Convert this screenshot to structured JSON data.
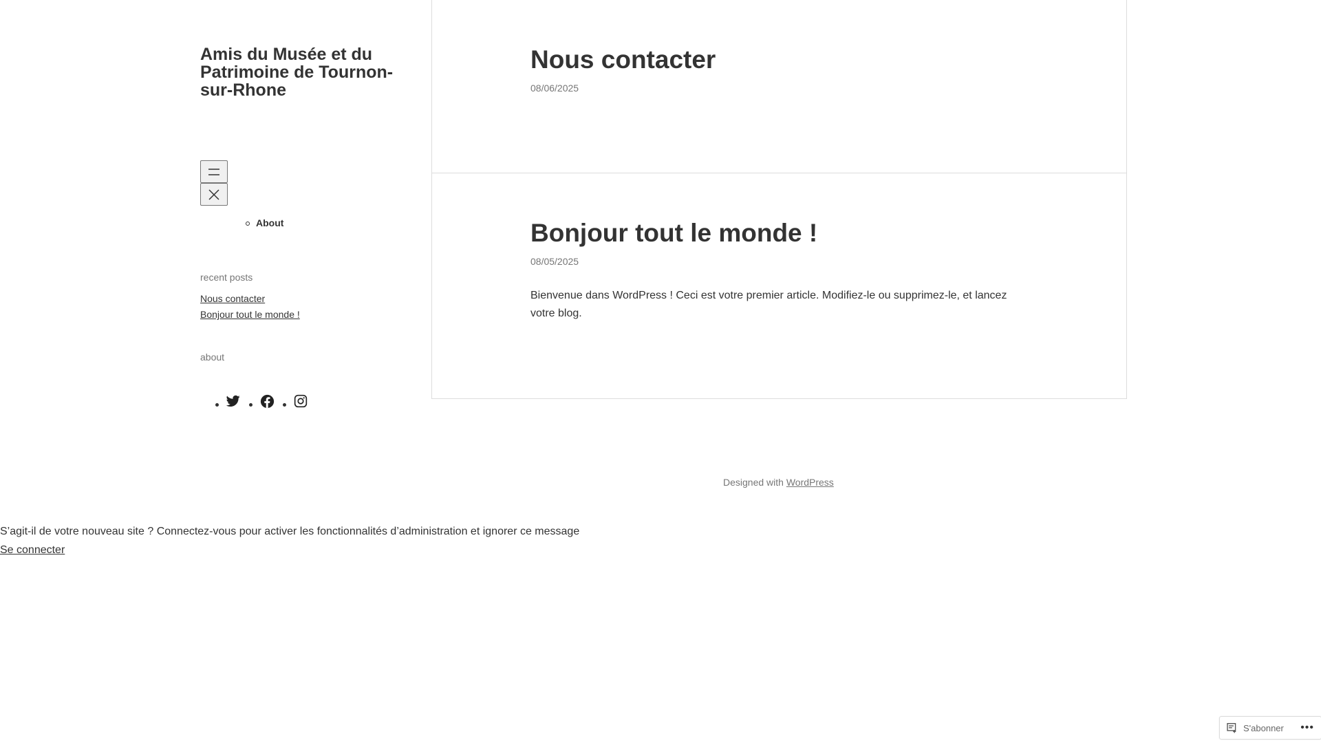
{
  "site": {
    "title": "Amis du Musée et du Patrimoine de Tournon-sur-Rhone"
  },
  "navigation": {
    "items": [
      {
        "label": "About"
      }
    ]
  },
  "sidebar": {
    "recent_posts_title": "recent posts",
    "recent_posts": [
      {
        "label": "Nous contacter"
      },
      {
        "label": "Bonjour tout le monde !"
      }
    ],
    "about_title": "about",
    "social_icons": [
      "twitter-icon",
      "facebook-icon",
      "instagram-icon"
    ]
  },
  "posts": [
    {
      "title": "Nous contacter",
      "date": "08/06/2025"
    },
    {
      "title": "Bonjour tout le monde !",
      "date": "08/05/2025",
      "body": "Bienvenue dans WordPress ! Ceci est votre premier article. Modifiez-le ou supprimez-le, et lancez votre blog."
    }
  ],
  "footer": {
    "prefix": "Designed with",
    "link_label": "WordPress"
  },
  "notice": {
    "message": "S’agit-il de votre nouveau site ? Connectez-vous pour activer les fonctionnalités d’administration et ignorer ce message",
    "login_label": "Se connecter"
  },
  "subscribe_bar": {
    "label": "S'abonner",
    "more": "•••"
  },
  "colors": {
    "text": "#333333",
    "muted": "#767676",
    "border": "#dcdcdc"
  }
}
